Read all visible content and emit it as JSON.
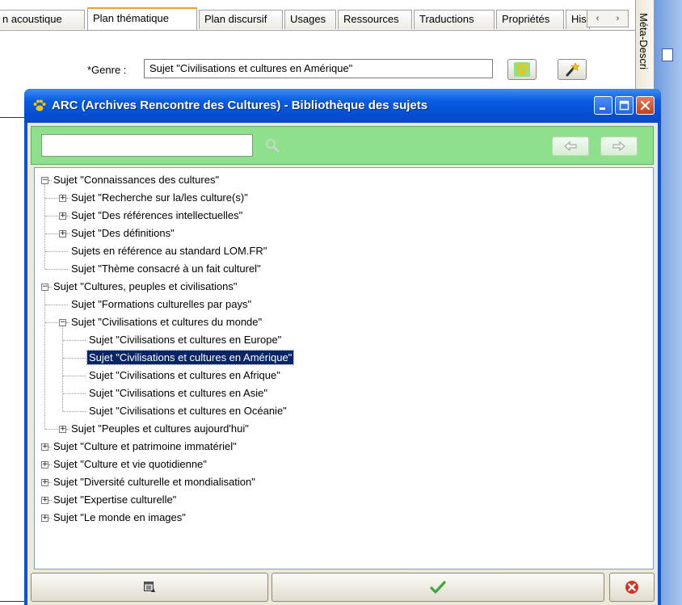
{
  "tabs": [
    {
      "label": "n acoustique",
      "active": false
    },
    {
      "label": "Plan thématique",
      "active": true
    },
    {
      "label": "Plan discursif",
      "active": false
    },
    {
      "label": "Usages",
      "active": false
    },
    {
      "label": "Ressources",
      "active": false
    },
    {
      "label": "Traductions",
      "active": false
    },
    {
      "label": "Propriétés",
      "active": false
    },
    {
      "label": "His",
      "active": false
    }
  ],
  "tab_scroll": {
    "left": "‹",
    "right": "›"
  },
  "side_panel": {
    "label": "Méta-Descri"
  },
  "genre": {
    "label": "*Genre :",
    "value": "Sujet \"Civilisations et cultures en Amérique\""
  },
  "dialog": {
    "title": "ARC (Archives Rencontre des Cultures) - Bibliothèque des sujets",
    "search": {
      "value": "",
      "placeholder": ""
    },
    "tree": [
      {
        "label": "Sujet \"Connaissances des cultures\"",
        "level": 0,
        "expander": "minus"
      },
      {
        "label": "Sujet \"Recherche sur la/les culture(s)\"",
        "level": 1,
        "expander": "plus"
      },
      {
        "label": "Sujet \"Des références intellectuelles\"",
        "level": 1,
        "expander": "plus"
      },
      {
        "label": "Sujet \"Des définitions\"",
        "level": 1,
        "expander": "plus"
      },
      {
        "label": "Sujets en référence au standard LOM.FR\"",
        "level": 1,
        "expander": "none"
      },
      {
        "label": "Sujet \"Thème consacré à un fait culturel\"",
        "level": 1,
        "expander": "none"
      },
      {
        "label": "Sujet \"Cultures, peuples et civilisations\"",
        "level": 0,
        "expander": "minus"
      },
      {
        "label": "Sujet \"Formations culturelles par pays\"",
        "level": 1,
        "expander": "none"
      },
      {
        "label": "Sujet \"Civilisations et cultures du monde\"",
        "level": 1,
        "expander": "minus"
      },
      {
        "label": "Sujet \"Civilisations et cultures en Europe\"",
        "level": 2,
        "expander": "none"
      },
      {
        "label": "Sujet \"Civilisations et cultures en Amérique\"",
        "level": 2,
        "expander": "none",
        "selected": true
      },
      {
        "label": "Sujet \"Civilisations et cultures en Afrique\"",
        "level": 2,
        "expander": "none"
      },
      {
        "label": "Sujet \"Civilisations et cultures en Asie\"",
        "level": 2,
        "expander": "none"
      },
      {
        "label": "Sujet \"Civilisations et cultures en Océanie\"",
        "level": 2,
        "expander": "none"
      },
      {
        "label": "Sujet \"Peuples et cultures aujourd'hui\"",
        "level": 1,
        "expander": "plus"
      },
      {
        "label": "Sujet \"Culture et patrimoine immatériel\"",
        "level": 0,
        "expander": "plus"
      },
      {
        "label": "Sujet \"Culture et vie quotidienne\"",
        "level": 0,
        "expander": "plus"
      },
      {
        "label": "Sujet \"Diversité culturelle et mondialisation\"",
        "level": 0,
        "expander": "plus"
      },
      {
        "label": "Sujet \"Expertise culturelle\"",
        "level": 0,
        "expander": "plus"
      },
      {
        "label": "Sujet \"Le monde en images\"",
        "level": 0,
        "expander": "plus"
      }
    ]
  },
  "icons": {
    "genre_browse": "paw-icon",
    "genre_edit": "magic-wand-icon",
    "title": "paw-icon",
    "search": "magnifier-icon",
    "nav_back": "arrow-left-icon",
    "nav_forward": "arrow-right-icon",
    "footer_left": "window-icon",
    "footer_ok": "check-icon",
    "footer_cancel": "cancel-icon"
  },
  "colors": {
    "title_bar": "#0a5ce2",
    "search_bar": "#8fe08c",
    "selection": "#0a246a",
    "active_tab": "#f0a030",
    "ok_check": "#3aa83a",
    "cancel_red": "#d83020"
  }
}
